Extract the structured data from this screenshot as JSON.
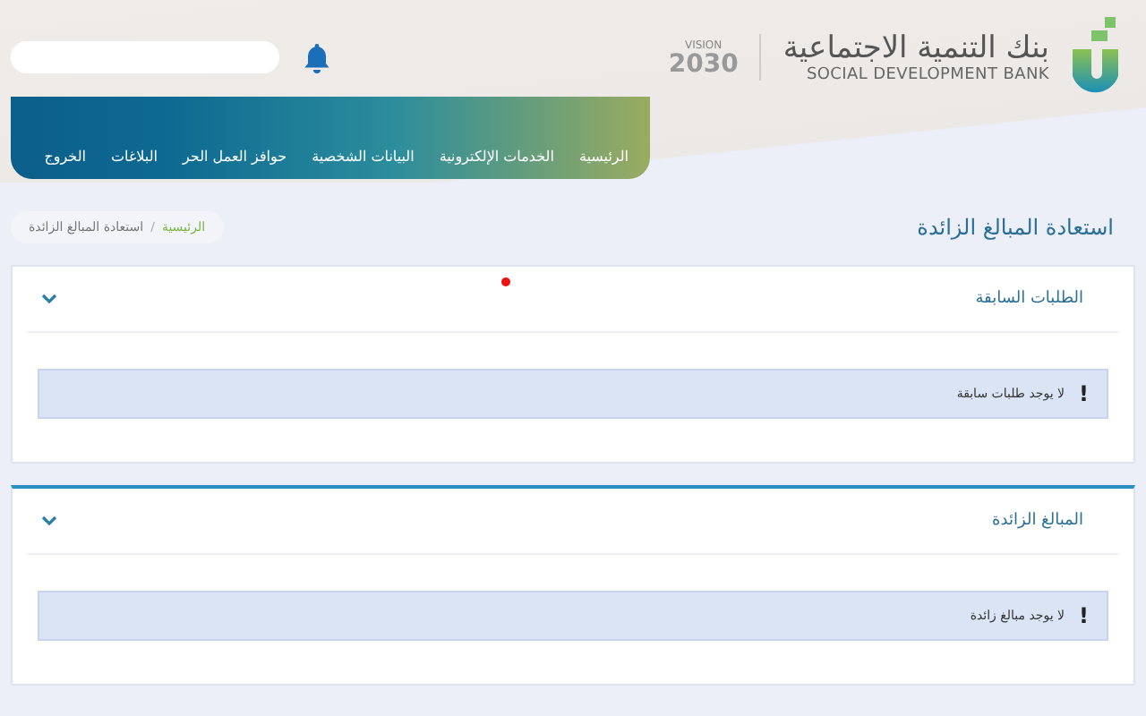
{
  "header": {
    "bank_name_ar": "بنك التنمية الاجتماعية",
    "bank_name_en": "SOCIAL DEVELOPMENT BANK",
    "vision": {
      "label": "VISION",
      "year": "2030"
    }
  },
  "nav": {
    "items": [
      {
        "label": "الرئيسية"
      },
      {
        "label": "الخدمات الإلكترونية"
      },
      {
        "label": "البيانات الشخصية"
      },
      {
        "label": "حوافز العمل الحر"
      },
      {
        "label": "البلاغات"
      },
      {
        "label": "الخروج"
      }
    ]
  },
  "page": {
    "title": "استعادة المبالغ الزائدة",
    "breadcrumb": [
      {
        "label": "الرئيسية",
        "kind": "link"
      },
      {
        "label": "/",
        "kind": "separator"
      },
      {
        "label": "استعادة المبالغ الزائدة",
        "kind": "current"
      }
    ]
  },
  "sections": [
    {
      "title": "الطلبات السابقة",
      "expanded": true,
      "highlighted": false,
      "alert": {
        "icon": "!",
        "message": "لا يوجد طلبات سابقة"
      }
    },
    {
      "title": "المبالغ الزائدة",
      "expanded": true,
      "highlighted": true,
      "alert": {
        "icon": "!",
        "message": "لا يوجد مبالغ زائدة"
      }
    }
  ]
}
